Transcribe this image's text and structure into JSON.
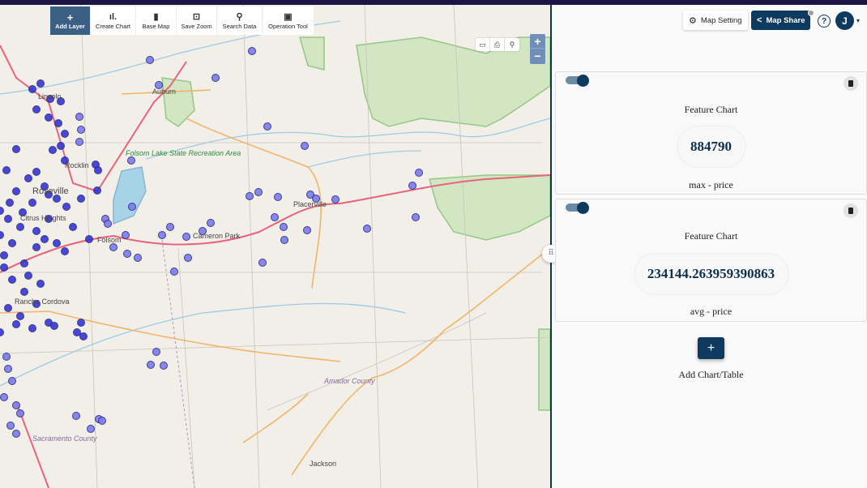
{
  "toolbar": {
    "items": [
      {
        "label": "Add Layer",
        "icon": "plus-icon",
        "glyph": "+"
      },
      {
        "label": "Create Chart",
        "icon": "bar-chart-icon",
        "glyph": "ıl."
      },
      {
        "label": "Base Map",
        "icon": "map-icon",
        "glyph": "▮"
      },
      {
        "label": "Save Zoom",
        "icon": "focus-icon",
        "glyph": "⊡"
      },
      {
        "label": "Search Data",
        "icon": "search-icon",
        "glyph": "⚲"
      },
      {
        "label": "Operation Tool",
        "icon": "chart-box-icon",
        "glyph": "▣"
      }
    ]
  },
  "map_controls": {
    "measure_icon": "▭",
    "print_icon": "⎙",
    "search_icon": "⚲",
    "zoom_in": "+",
    "zoom_out": "−"
  },
  "map_labels": {
    "auburn": "Auburn",
    "lincoln": "Lincoln",
    "rocklin": "Rocklin",
    "roseville": "Roseville",
    "folsom_lake": "Folsom Lake State Recreation Area",
    "citrus_heights": "Citrus Heights",
    "folsom": "Folsom",
    "cameron_park": "Cameron Park",
    "placerville": "Placerville",
    "rancho_cordova": "Rancho Cordova",
    "sacramento_county": "Sacramento County",
    "amador_county": "Amador County",
    "jackson": "Jackson"
  },
  "header": {
    "map_setting_label": "Map Setting",
    "map_share_label": "Map Share",
    "help_icon": "?",
    "avatar_initial": "J",
    "caret": "▾"
  },
  "cards": [
    {
      "title": "Feature Chart",
      "value": "884790",
      "label": "max - price",
      "enabled": true
    },
    {
      "title": "Feature Chart",
      "value": "234144.263959390863",
      "label": "avg - price",
      "enabled": true
    }
  ],
  "add_chart": {
    "icon": "+",
    "label": "Add Chart/Table"
  },
  "resize_handle_glyph": "⠿",
  "colors": {
    "primary": "#0d3a5e",
    "toolbar_active": "#3b5f85",
    "top_bar": "#1b1444",
    "marker_fill": "#7b7bf0",
    "marker_stroke": "#2a2a7a"
  }
}
